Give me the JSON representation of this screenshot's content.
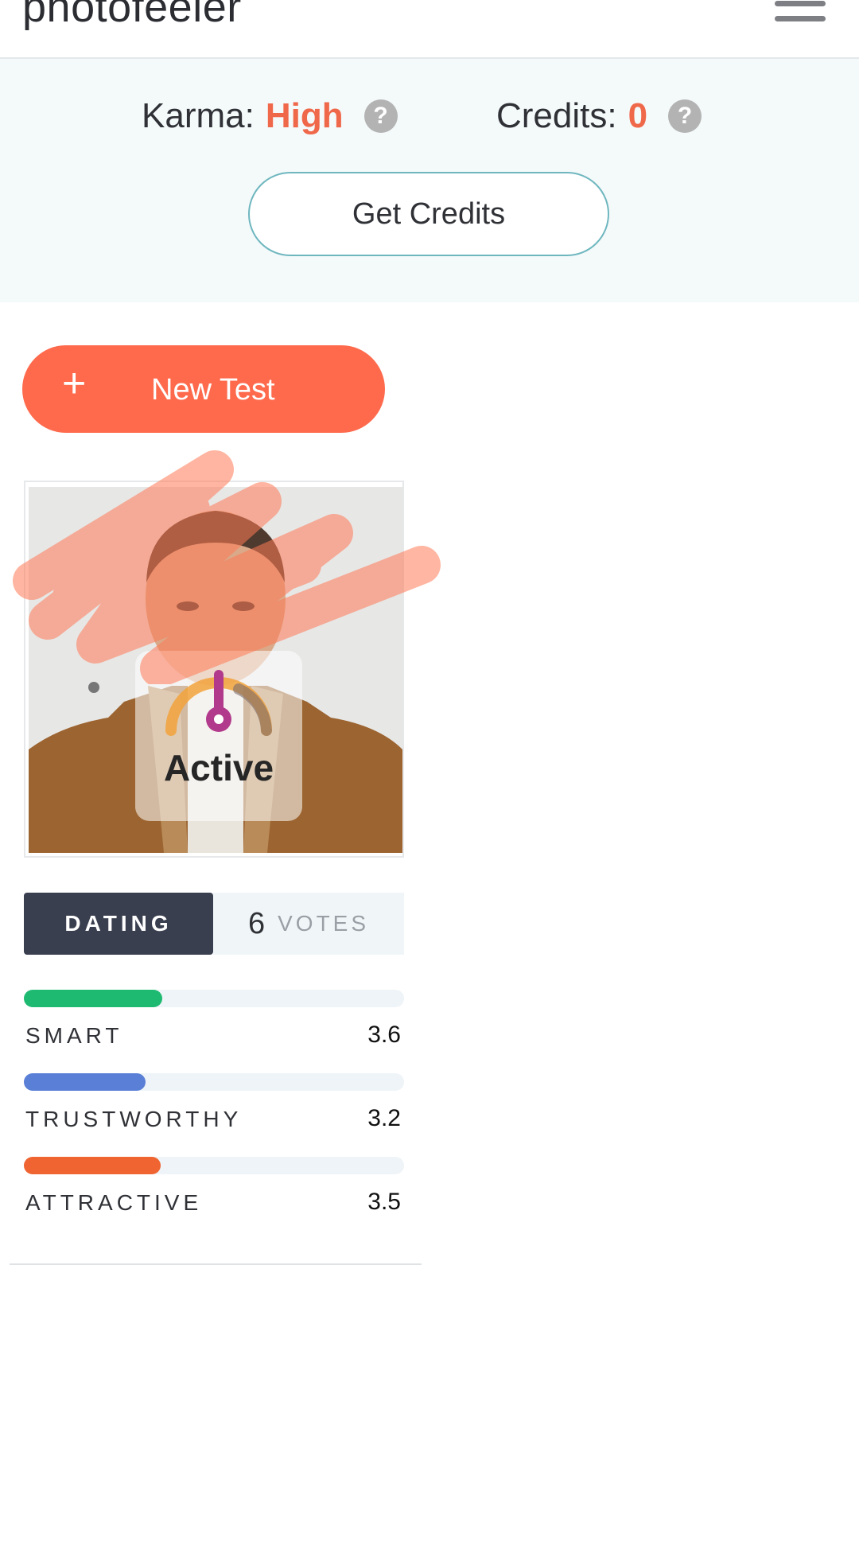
{
  "header": {
    "logo_text": "photofeeler"
  },
  "stats": {
    "karma_label": "Karma:",
    "karma_value": "High",
    "credits_label": "Credits:",
    "credits_value": "0",
    "help_glyph": "?",
    "get_credits_label": "Get Credits"
  },
  "new_test": {
    "plus": "+",
    "label": "New Test"
  },
  "photo_card": {
    "status_label": "Active"
  },
  "test_result": {
    "category": "DATING",
    "votes_count": "6",
    "votes_label": "VOTES",
    "ratings": [
      {
        "name": "SMART",
        "score": "3.6",
        "fill_fraction": 0.365,
        "color": "#1fba72"
      },
      {
        "name": "TRUSTWORTHY",
        "score": "3.2",
        "fill_fraction": 0.32,
        "color": "#5a7fd6"
      },
      {
        "name": "ATTRACTIVE",
        "score": "3.5",
        "fill_fraction": 0.36,
        "color": "#ef6431"
      }
    ]
  },
  "colors": {
    "accent": "#ff6a4d",
    "value_highlight": "#f0684a",
    "tab_dark": "#3a3f4f",
    "outline": "#6fb7bf"
  },
  "icons": [
    "menu-icon",
    "help-icon",
    "plus-icon",
    "gauge-icon"
  ]
}
